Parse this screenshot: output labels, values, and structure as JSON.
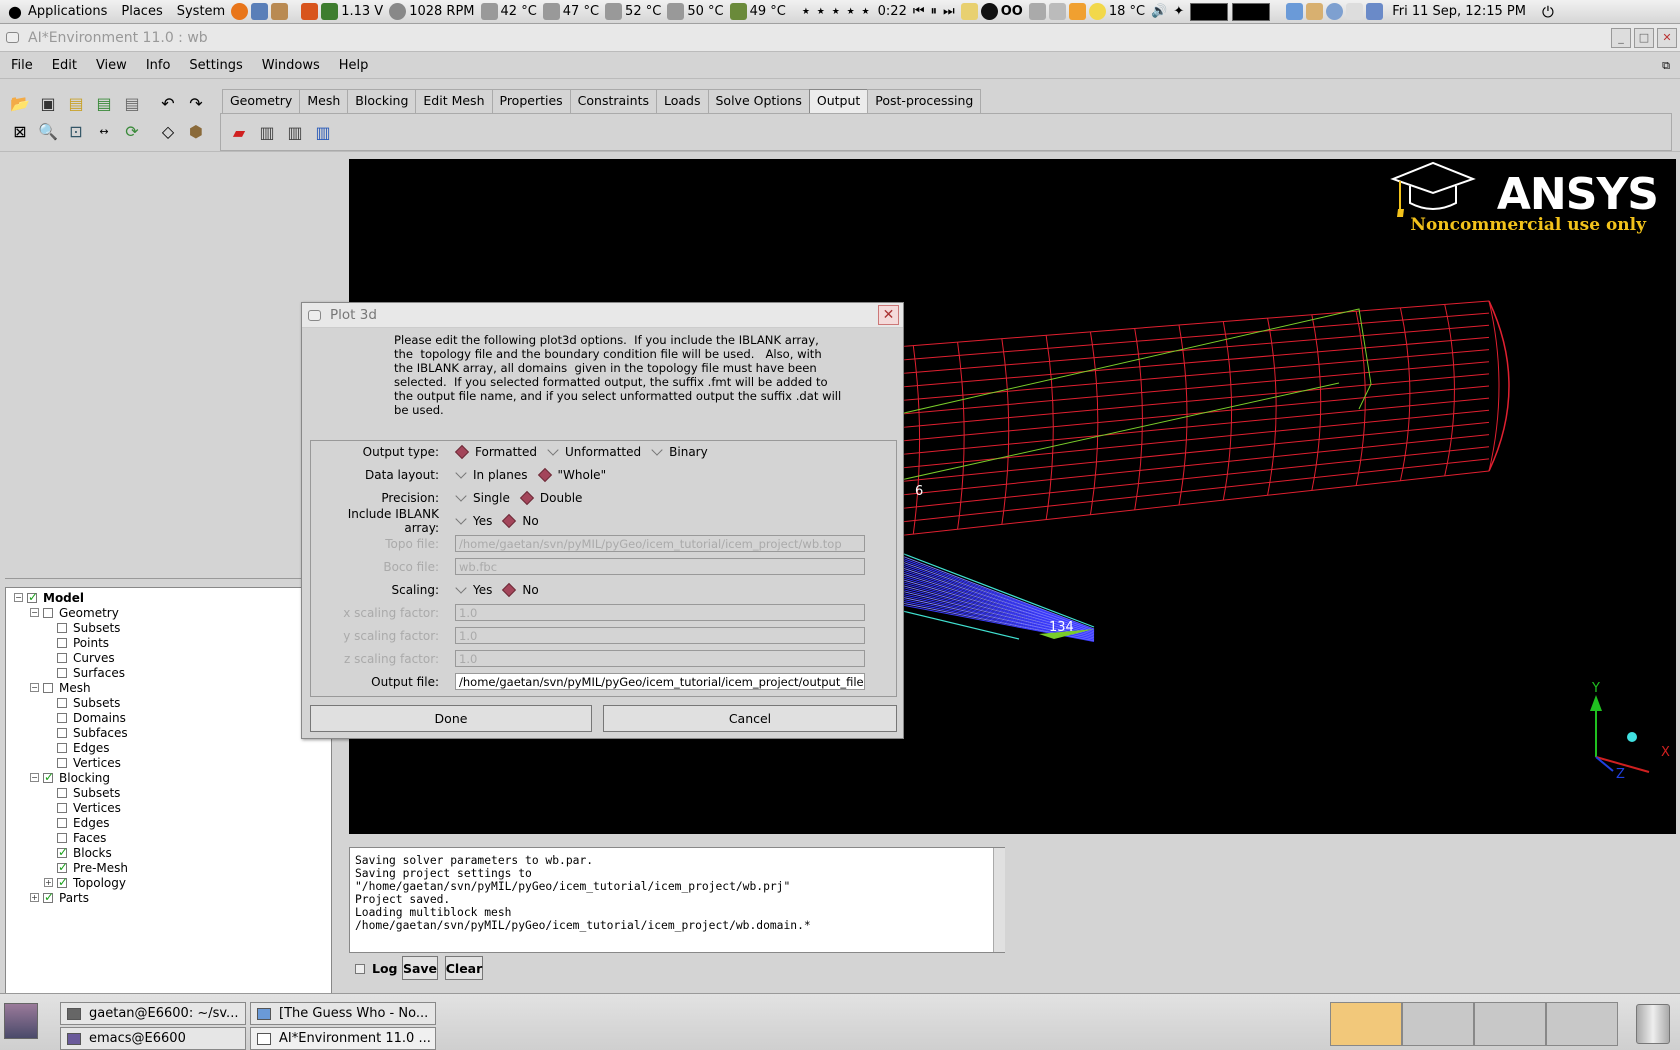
{
  "top_panel": {
    "menus": [
      "Applications",
      "Places",
      "System"
    ],
    "cpu_freq": "1.13 V",
    "fan": "1028 RPM",
    "temps": [
      "42 °C",
      "47 °C",
      "52 °C",
      "50 °C",
      "49 °C"
    ],
    "stars": "★ ★ ★ ★ ★",
    "media_time": "0:22",
    "weather": "18 °C",
    "clock": "Fri 11 Sep, 12:15 PM"
  },
  "window": {
    "title": "AI*Environment 11.0 : wb",
    "menu": [
      "File",
      "Edit",
      "View",
      "Info",
      "Settings",
      "Windows",
      "Help"
    ]
  },
  "tabs": [
    "Geometry",
    "Mesh",
    "Blocking",
    "Edit Mesh",
    "Properties",
    "Constraints",
    "Loads",
    "Solve Options",
    "Output",
    "Post-processing"
  ],
  "active_tab": "Output",
  "tree": [
    {
      "label": "Model",
      "level": 0,
      "checked": true,
      "bold": true
    },
    {
      "label": "Geometry",
      "level": 1,
      "checked": false
    },
    {
      "label": "Subsets",
      "level": 2,
      "checked": false
    },
    {
      "label": "Points",
      "level": 2,
      "checked": false
    },
    {
      "label": "Curves",
      "level": 2,
      "checked": false
    },
    {
      "label": "Surfaces",
      "level": 2,
      "checked": false
    },
    {
      "label": "Mesh",
      "level": 1,
      "checked": false
    },
    {
      "label": "Subsets",
      "level": 2,
      "checked": false
    },
    {
      "label": "Domains",
      "level": 2,
      "checked": false
    },
    {
      "label": "Subfaces",
      "level": 2,
      "checked": false
    },
    {
      "label": "Edges",
      "level": 2,
      "checked": false
    },
    {
      "label": "Vertices",
      "level": 2,
      "checked": false
    },
    {
      "label": "Blocking",
      "level": 1,
      "checked": true
    },
    {
      "label": "Subsets",
      "level": 2,
      "checked": false
    },
    {
      "label": "Vertices",
      "level": 2,
      "checked": false
    },
    {
      "label": "Edges",
      "level": 2,
      "checked": false
    },
    {
      "label": "Faces",
      "level": 2,
      "checked": false
    },
    {
      "label": "Blocks",
      "level": 2,
      "checked": true
    },
    {
      "label": "Pre-Mesh",
      "level": 2,
      "checked": true
    },
    {
      "label": "Topology",
      "level": 2,
      "checked": true
    },
    {
      "label": "Parts",
      "level": 1,
      "checked": true
    }
  ],
  "viewport": {
    "brand": "ANSYS",
    "brand_note": "Noncommercial use only",
    "label_a": "6",
    "label_b": "134",
    "axis_y": "Y",
    "axis_x": "X",
    "axis_z": "Z"
  },
  "console": {
    "text": "Saving solver parameters to wb.par.\nSaving project settings to\n\"/home/gaetan/svn/pyMIL/pyGeo/icem_tutorial/icem_project/wb.prj\"\nProject saved.\nLoading multiblock mesh\n/home/gaetan/svn/pyMIL/pyGeo/icem_tutorial/icem_project/wb.domain.*",
    "log_label": "Log",
    "save_label": "Save",
    "clear_label": "Clear"
  },
  "dialog": {
    "title": "Plot 3d",
    "description": "Please edit the following plot3d options.  If you include the IBLANK array,\nthe  topology file and the boundary condition file will be used.   Also, with\nthe IBLANK array, all domains  given in the topology file must have been\nselected.  If you selected formatted output, the suffix .fmt will be added to\nthe output file name, and if you select unformatted output the suffix .dat will\nbe used.",
    "output_type_label": "Output type:",
    "output_type_options": [
      "Formatted",
      "Unformatted",
      "Binary"
    ],
    "output_type_selected": "Formatted",
    "data_layout_label": "Data layout:",
    "data_layout_options": [
      "In planes",
      "\"Whole\""
    ],
    "data_layout_selected": "\"Whole\"",
    "precision_label": "Precision:",
    "precision_options": [
      "Single",
      "Double"
    ],
    "precision_selected": "Double",
    "iblank_label": "Include IBLANK array:",
    "iblank_options": [
      "Yes",
      "No"
    ],
    "iblank_selected": "No",
    "topo_label": "Topo file:",
    "topo_value": "/home/gaetan/svn/pyMIL/pyGeo/icem_tutorial/icem_project/wb.top",
    "boco_label": "Boco file:",
    "boco_value": "wb.fbc",
    "scaling_label": "Scaling:",
    "scaling_options": [
      "Yes",
      "No"
    ],
    "scaling_selected": "No",
    "x_scale_label": "x scaling factor:",
    "x_scale_value": "1.0",
    "y_scale_label": "y scaling factor:",
    "y_scale_value": "1.0",
    "z_scale_label": "z scaling factor:",
    "z_scale_value": "1.0",
    "output_file_label": "Output file:",
    "output_file_value": "/home/gaetan/svn/pyMIL/pyGeo/icem_tutorial/icem_project/output_file",
    "done_label": "Done",
    "cancel_label": "Cancel"
  },
  "taskbar": [
    "gaetan@E6600: ~/sv...",
    "[The Guess Who - No...",
    "emacs@E6600",
    "AI*Environment 11.0 ..."
  ],
  "colors": {
    "mesh_red": "#e02030",
    "mesh_blue": "#3b3bff",
    "brand_gold": "#f2c21b",
    "radio_on": "#a3455a"
  }
}
